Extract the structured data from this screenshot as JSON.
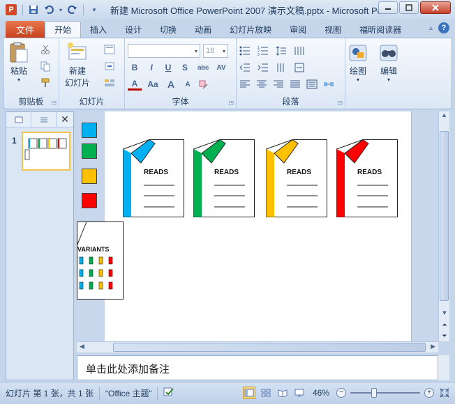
{
  "window": {
    "title": "新建 Microsoft Office PowerPoint 2007 演示文稿.pptx - Microsoft PowerPoint",
    "app_icon_letter": "P"
  },
  "tabs": {
    "file": "文件",
    "items": [
      "开始",
      "插入",
      "设计",
      "切换",
      "动画",
      "幻灯片放映",
      "审阅",
      "视图",
      "福昕阅读器"
    ],
    "active": "开始"
  },
  "ribbon": {
    "clipboard": {
      "label": "剪贴板",
      "paste": "粘贴"
    },
    "slides": {
      "label": "幻灯片",
      "new_slide_line1": "新建",
      "new_slide_line2": "幻灯片"
    },
    "font": {
      "label": "字体",
      "font_size": "18",
      "bold": "B",
      "italic": "I",
      "underline": "U",
      "shadow": "S",
      "strike": "abc",
      "spacing": "AV",
      "font_color": "A",
      "case": "Aa",
      "grow": "A",
      "shrink": "A"
    },
    "paragraph": {
      "label": "段落"
    },
    "drawing": {
      "label": "绘图"
    },
    "editing": {
      "label": "编辑"
    }
  },
  "thumbnails": {
    "slide_number": "1"
  },
  "slide": {
    "swatch_colors": [
      "#00b0f0",
      "#00b050",
      "#ffc000",
      "#ff0000"
    ],
    "docs": [
      {
        "label": "READS",
        "color": "#00b0f0"
      },
      {
        "label": "READS",
        "color": "#00b050"
      },
      {
        "label": "READS",
        "color": "#ffc000"
      },
      {
        "label": "READS",
        "color": "#ff0000"
      }
    ],
    "variants": {
      "label": "VARIANTS"
    }
  },
  "notes": {
    "placeholder": "单击此处添加备注"
  },
  "statusbar": {
    "slide_info": "幻灯片 第 1 张，共 1 张",
    "theme": "“Office 主题”",
    "zoom": "46%"
  }
}
